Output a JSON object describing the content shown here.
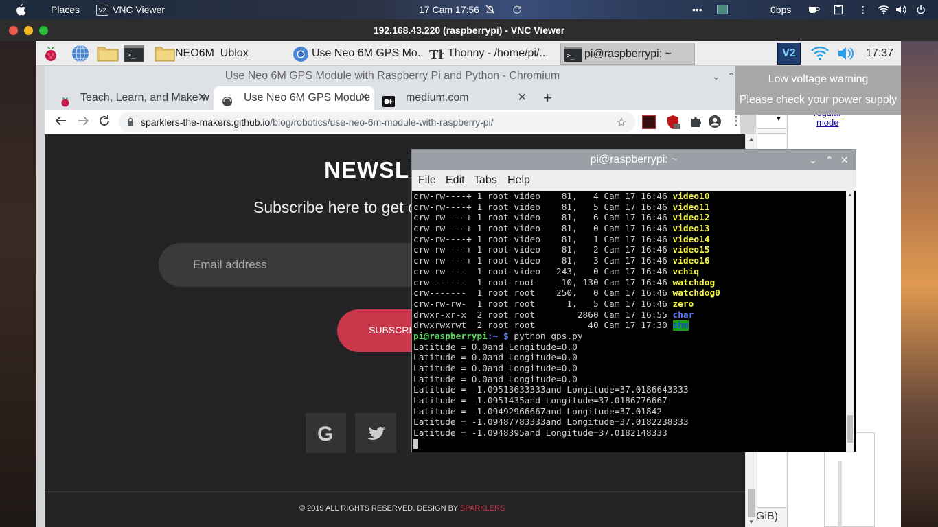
{
  "os_bar": {
    "places": "Places",
    "app_name": "VNC Viewer",
    "app_icon_text": "V2",
    "datetime": "17 Cam  17:56",
    "net_speed": "0bps"
  },
  "vnc_window": {
    "title": "192.168.43.220 (raspberrypi) - VNC Viewer"
  },
  "lxpanel": {
    "task_folder": "NEO6M_Ublox",
    "task_chromium": "Use Neo 6M GPS Mo...",
    "task_thonny": "Thonny  -  /home/pi/...",
    "task_terminal": "pi@raspberrypi: ~",
    "vnc_tray_text": "V2",
    "time": "17:37"
  },
  "notification": {
    "line1": "Low voltage warning",
    "line2": "Please check your power supply"
  },
  "chromium": {
    "window_title": "Use Neo 6M GPS Module with Raspberry Pi and Python - Chromium",
    "tabs": [
      {
        "label": "Teach, Learn, and Make w"
      },
      {
        "label": "Use Neo 6M GPS Module"
      },
      {
        "label": "medium.com"
      }
    ],
    "new_tab": "+",
    "url_domain": "sparklers-the-makers.github.io",
    "url_path": "/blog/robotics/use-neo-6m-module-with-raspberry-pi/"
  },
  "page": {
    "newsletter_heading": "NEWSLE",
    "subscribe_text": "Subscribe here to get o",
    "email_placeholder": "Email address",
    "subscribe_button": "SUBSCRI",
    "footer_text": "© 2019 ALL RIGHTS RESERVED. DESIGN BY",
    "footer_brand": "SPARKLERS",
    "side_link_1": "regular",
    "side_link_2": "mode",
    "side_text": "GiB)"
  },
  "terminal": {
    "title": "pi@raspberrypi: ~",
    "menu": [
      "File",
      "Edit",
      "Tabs",
      "Help"
    ],
    "prompt_user": "pi@raspberrypi",
    "prompt_path": ":~ $",
    "command": "python gps.py",
    "listing": [
      {
        "meta": "crw-rw----+ 1 root video    81,   4 Cam 17 16:46 ",
        "name": "video10",
        "style": "yellow"
      },
      {
        "meta": "crw-rw----+ 1 root video    81,   5 Cam 17 16:46 ",
        "name": "video11",
        "style": "yellow"
      },
      {
        "meta": "crw-rw----+ 1 root video    81,   6 Cam 17 16:46 ",
        "name": "video12",
        "style": "yellow"
      },
      {
        "meta": "crw-rw----+ 1 root video    81,   0 Cam 17 16:46 ",
        "name": "video13",
        "style": "yellow"
      },
      {
        "meta": "crw-rw----+ 1 root video    81,   1 Cam 17 16:46 ",
        "name": "video14",
        "style": "yellow"
      },
      {
        "meta": "crw-rw----+ 1 root video    81,   2 Cam 17 16:46 ",
        "name": "video15",
        "style": "yellow"
      },
      {
        "meta": "crw-rw----+ 1 root video    81,   3 Cam 17 16:46 ",
        "name": "video16",
        "style": "yellow"
      },
      {
        "meta": "crw-rw----  1 root video   243,   0 Cam 17 16:46 ",
        "name": "vchiq",
        "style": "yellow"
      },
      {
        "meta": "crw-------  1 root root     10, 130 Cam 17 16:46 ",
        "name": "watchdog",
        "style": "yellow"
      },
      {
        "meta": "crw-------  1 root root    250,   0 Cam 17 16:46 ",
        "name": "watchdog0",
        "style": "yellow"
      },
      {
        "meta": "crw-rw-rw-  1 root root      1,   5 Cam 17 16:46 ",
        "name": "zero",
        "style": "yellow"
      },
      {
        "meta": "drwxr-xr-x  2 root root        2860 Cam 17 16:55 ",
        "name": "char",
        "style": "blue"
      },
      {
        "meta": "drwxrwxrwt  2 root root          40 Cam 17 17:30 ",
        "name": "shm",
        "style": "shm"
      }
    ],
    "output": [
      "Latitude = 0.0and Longitude=0.0",
      "Latitude = 0.0and Longitude=0.0",
      "Latitude = 0.0and Longitude=0.0",
      "Latitude = 0.0and Longitude=0.0",
      "Latitude = -1.09513633333and Longitude=37.0186643333",
      "Latitude = -1.0951435and Longitude=37.0186776667",
      "Latitude = -1.09492966667and Longitude=37.01842",
      "Latitude = -1.09487783333and Longitude=37.0182238333",
      "Latitude = -1.0948395and Longitude=37.0182148333"
    ]
  },
  "colors": {
    "accent_red": "#c8384a",
    "page_bg": "#232326",
    "terminal_yellow": "#f5f542"
  }
}
